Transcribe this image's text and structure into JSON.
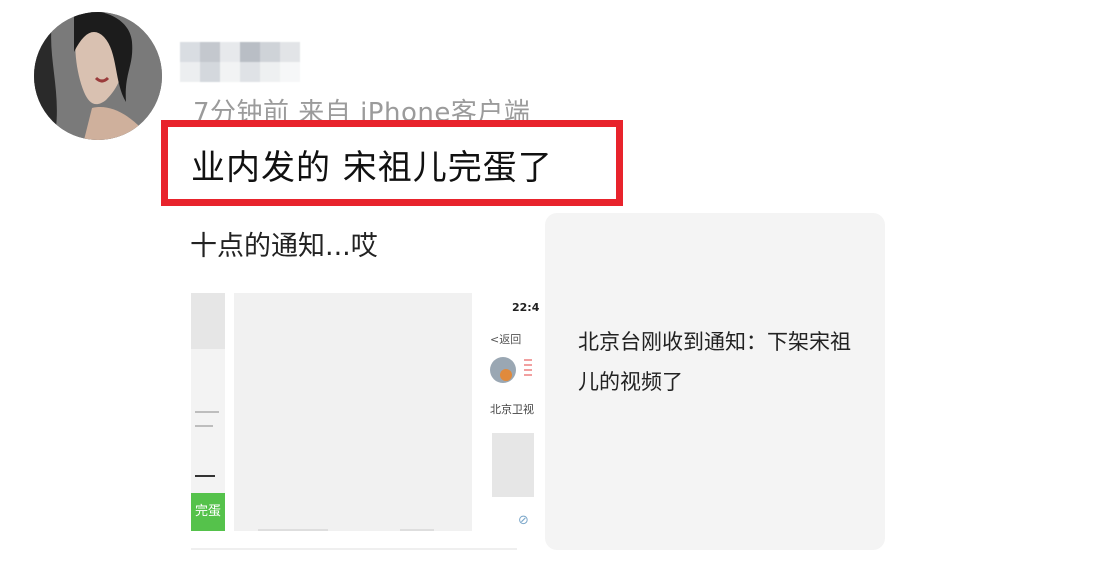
{
  "post": {
    "meta": "7分钟前  来自 iPhone客户端",
    "headline": "业内发的 宋祖儿完蛋了",
    "body": "十点的通知...哎",
    "card_text": "北京台刚收到通知：下架宋祖儿的视频了"
  },
  "thumbs": {
    "left_badge": "完蛋",
    "phone_time": "22:4",
    "phone_back": "<返回",
    "phone_name": "北京卫视"
  },
  "colors": {
    "highlight_box": "#e8232c",
    "meta_text": "#9b9b9b",
    "badge_green": "#55c24b"
  },
  "icons": {
    "phone_link": "link-icon"
  }
}
